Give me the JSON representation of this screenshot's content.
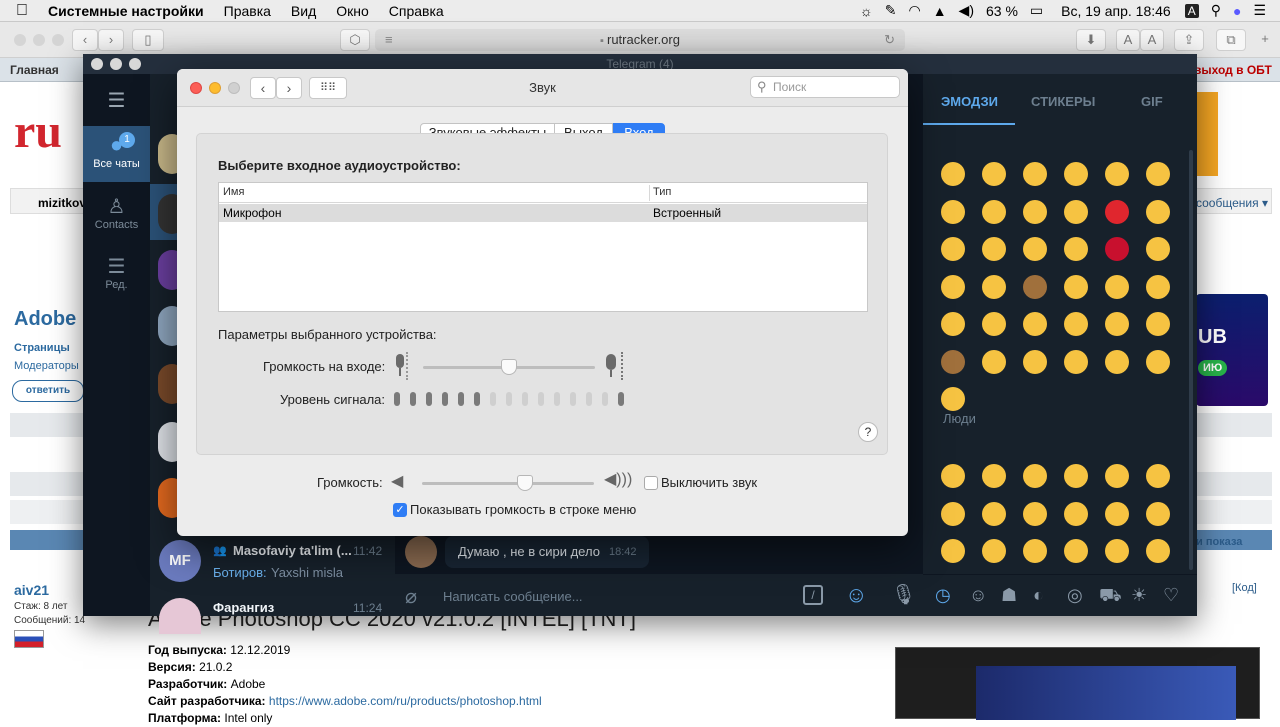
{
  "menubar": {
    "app": "Системные настройки",
    "items": [
      "Правка",
      "Вид",
      "Окно",
      "Справка"
    ],
    "battery": "63 %",
    "datetime": "Вс, 19 апр. 18:46",
    "input_lang": "A"
  },
  "safari": {
    "address": "rutracker.org"
  },
  "rutracker": {
    "nav_first": "Главная",
    "nav_right": "выход в ОБТ",
    "user_short": "mizitkov",
    "messages": "сообщения",
    "adobe": "Adobe",
    "pages": "Страницы",
    "moderators": "Модераторы",
    "reply": "ответить",
    "show": "и показа",
    "code": "[Код]",
    "username": "aiv21",
    "stage": "Стаж: 8 лет",
    "posts": "Сообщений: 14",
    "post_title": "Adobe Photoshop CC 2020 v21.0.2 [INTEL] [TNT]",
    "details": [
      {
        "k": "Год выпуска:",
        "v": "12.12.2019"
      },
      {
        "k": "Версия:",
        "v": "21.0.2"
      },
      {
        "k": "Разработчик:",
        "v": "Adobe"
      },
      {
        "k": "Сайт разработчика:",
        "v": "https://www.adobe.com/ru/products/photoshop.html"
      },
      {
        "k": "Платформа:",
        "v": "Intel only"
      }
    ],
    "banner_text": "UB",
    "banner_sub": "ИЮ"
  },
  "telegram": {
    "title": "Telegram (4)",
    "rail": {
      "all_chats": "Все чаты",
      "badge": "1",
      "contacts": "Contacts",
      "edit": "Ред."
    },
    "chats": [
      {
        "avatar": "MF",
        "name": "Masofaviy ta'lim (...",
        "time": "11:42",
        "sender": "Ботиров:",
        "preview": "Yaxshi misla"
      },
      {
        "avatar": "",
        "name": "Фарангиз",
        "time": "11:24",
        "sender": "",
        "preview": ""
      }
    ],
    "message": {
      "text": "Думаю , не в сири дело",
      "time": "18:42"
    },
    "composer_placeholder": "Написать сообщение...",
    "emoji_tabs": [
      "ЭМОДЗИ",
      "СТИКЕРЫ",
      "GIF"
    ],
    "section_people": "Люди"
  },
  "sound": {
    "title": "Звук",
    "search_placeholder": "Поиск",
    "tabs": [
      "Звуковые эффекты",
      "Выход",
      "Вход"
    ],
    "selected_tab": "Вход",
    "choose_label": "Выберите входное аудиоустройство:",
    "columns": [
      "Имя",
      "Тип"
    ],
    "devices": [
      {
        "name": "Микрофон",
        "type": "Встроенный"
      }
    ],
    "params_label": "Параметры выбранного устройства:",
    "input_volume_label": "Громкость на входе:",
    "input_volume": 0.5,
    "signal_label": "Уровень сигнала:",
    "signal_level_bars": 6,
    "signal_total_bars": 15,
    "help": "?",
    "output_volume_label": "Громкость:",
    "output_volume": 0.6,
    "mute_label": "Выключить звук",
    "mute_checked": false,
    "show_menu_label": "Показывать громкость в строке меню",
    "show_menu_checked": true
  }
}
